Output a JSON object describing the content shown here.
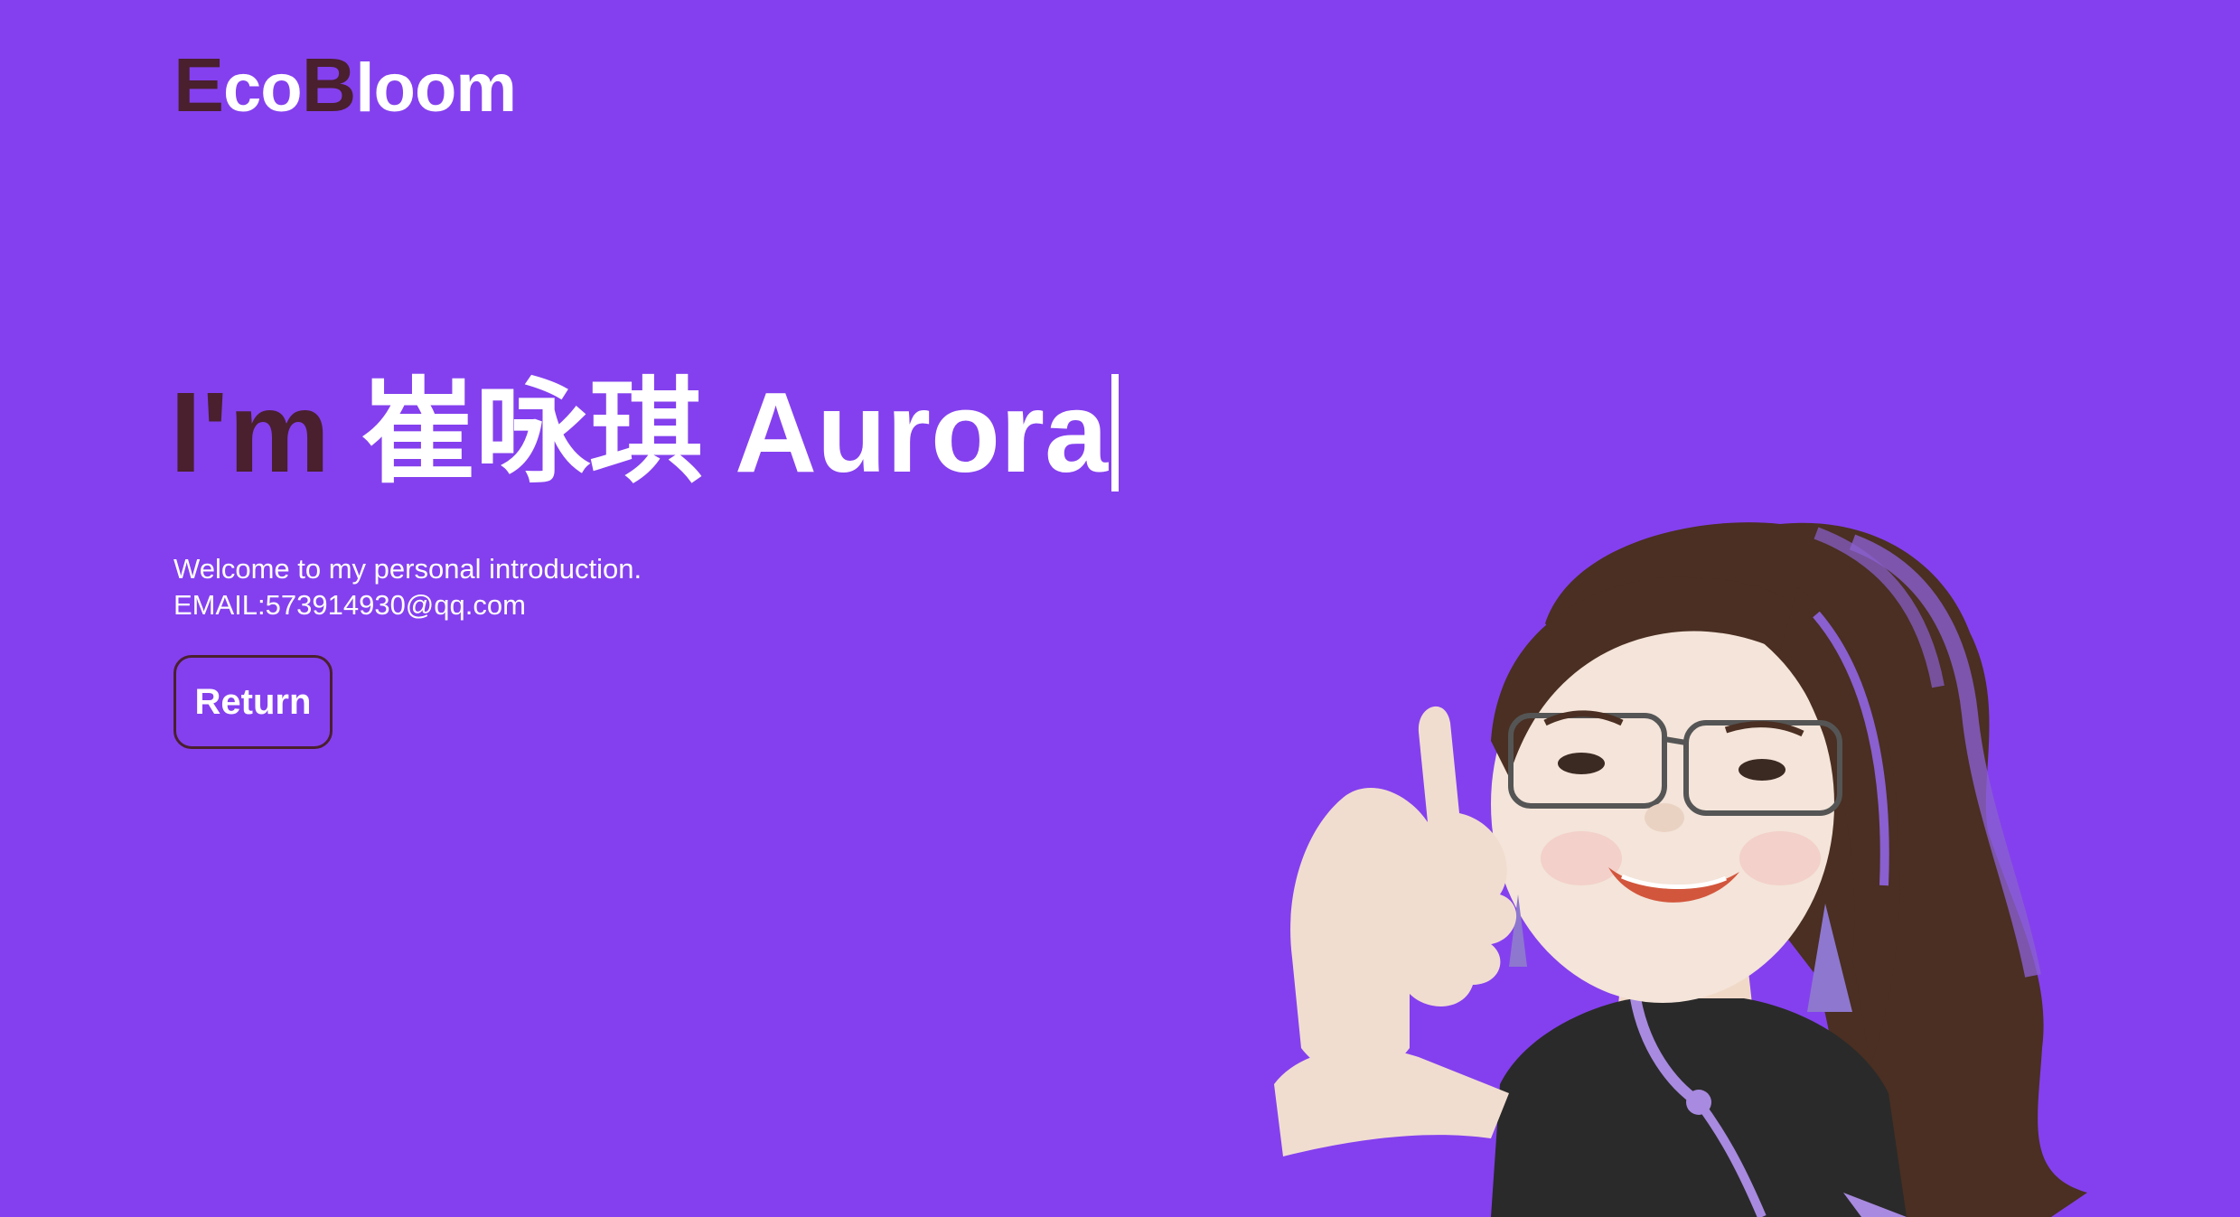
{
  "header": {
    "logo": {
      "initial_1": "E",
      "rest_1": "co",
      "initial_2": "B",
      "rest_2": "loom"
    }
  },
  "hero": {
    "lead": "I'm",
    "name": " 崔咏琪 Aurora"
  },
  "intro": {
    "welcome": "Welcome to my personal introduction.",
    "email": "EMAIL:573914930@qq.com"
  },
  "actions": {
    "return_label": "Return"
  },
  "colors": {
    "background": "#8440ee",
    "accent": "#4a1f2e",
    "text": "#ffffff"
  },
  "avatar": {
    "description_icon": "memoji-avatar"
  }
}
